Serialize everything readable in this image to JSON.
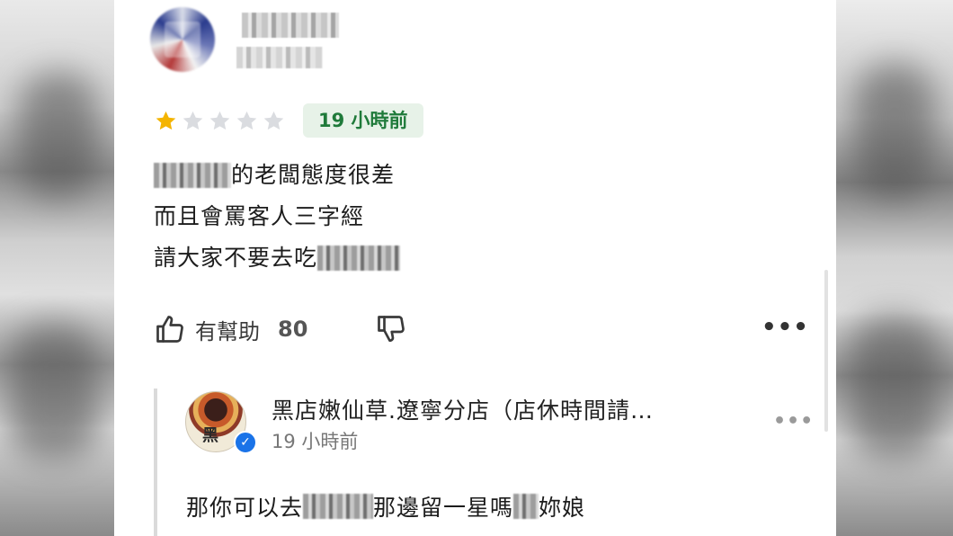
{
  "review": {
    "rating": 1,
    "rating_max": 5,
    "time": "19 小時前",
    "lines": [
      [
        "",
        "的老闆態度很差"
      ],
      [
        "",
        "而且會罵客人三字經"
      ],
      [
        "請大家不要去吃",
        ""
      ]
    ]
  },
  "actions": {
    "helpful_label": "有幫助",
    "helpful_count": "80",
    "more": "•••"
  },
  "reply": {
    "shop_name": "黑店嫩仙草.遼寧分店（店休時間請…",
    "time": "19 小時前",
    "more": "•••",
    "text_parts": [
      "那你可以去",
      "那邊留一星嗎",
      "妳娘"
    ],
    "avatar_mark": "黑"
  },
  "colors": {
    "star_filled": "#f4b400",
    "star_empty": "#dadce0",
    "badge_bg": "#e7f2e8",
    "badge_text": "#1f7a3a",
    "verified": "#1a73e8"
  }
}
